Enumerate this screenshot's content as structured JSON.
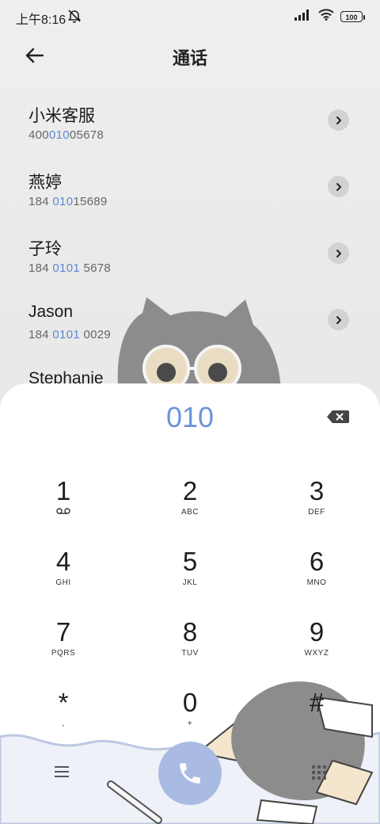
{
  "status": {
    "time": "上午8:16",
    "battery": "100"
  },
  "header": {
    "title": "通话"
  },
  "contacts": [
    {
      "name": "小米客服",
      "num_pre": "400",
      "num_hl": "010",
      "num_post": "05678"
    },
    {
      "name": "燕婷",
      "num_pre": "184 ",
      "num_hl": "010",
      "num_post": "15689"
    },
    {
      "name": "子玲",
      "num_pre": "184 ",
      "num_hl": "0101",
      "num_post": " 5678"
    },
    {
      "name": "Jason",
      "num_pre": "184 ",
      "num_hl": "0101",
      "num_post": " 0029"
    },
    {
      "name": "Stephanie",
      "num_pre": "",
      "num_hl": "",
      "num_post": ""
    }
  ],
  "dialer": {
    "input": "010",
    "keys": [
      {
        "digit": "1",
        "letters": ""
      },
      {
        "digit": "2",
        "letters": "ABC"
      },
      {
        "digit": "3",
        "letters": "DEF"
      },
      {
        "digit": "4",
        "letters": "GHI"
      },
      {
        "digit": "5",
        "letters": "JKL"
      },
      {
        "digit": "6",
        "letters": "MNO"
      },
      {
        "digit": "7",
        "letters": "PQRS"
      },
      {
        "digit": "8",
        "letters": "TUV"
      },
      {
        "digit": "9",
        "letters": "WXYZ"
      },
      {
        "digit": "*",
        "letters": ","
      },
      {
        "digit": "0",
        "letters": "+"
      },
      {
        "digit": "#",
        "letters": ""
      }
    ]
  },
  "colors": {
    "accent": "#6b93da",
    "call_button": "#a9bbe2"
  },
  "icons": {
    "back": "arrow-left-icon",
    "mute": "bell-mute-icon",
    "delete": "backspace-icon",
    "menu": "menu-icon",
    "call": "phone-icon",
    "keypad": "dialpad-icon"
  }
}
